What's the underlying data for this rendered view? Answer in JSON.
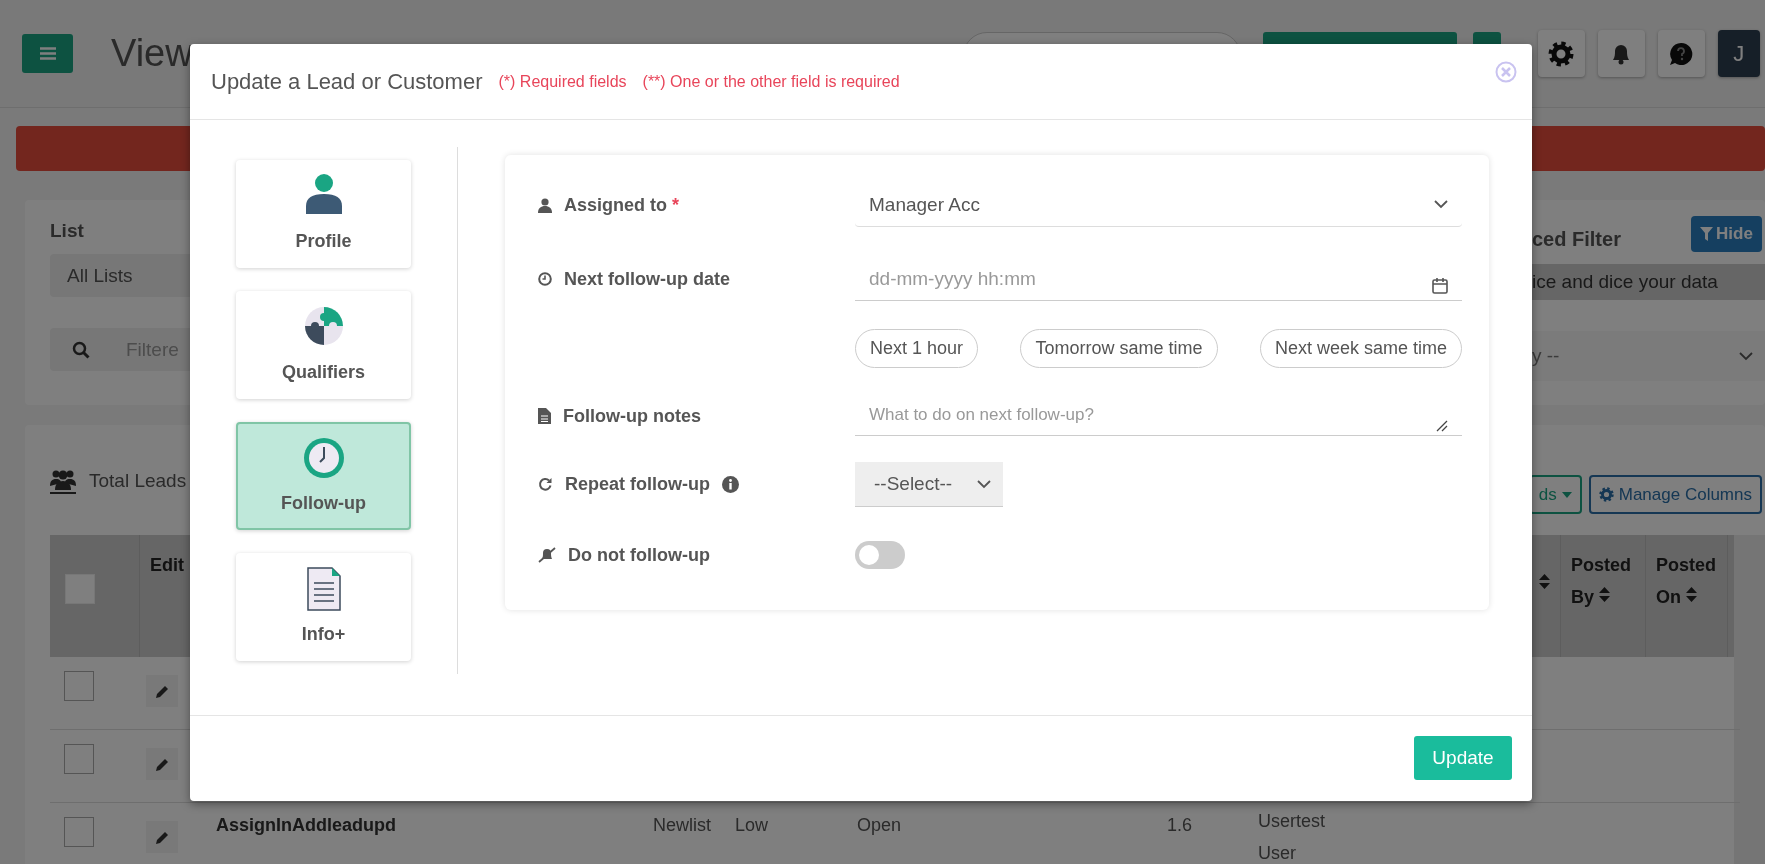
{
  "topbar": {
    "page_title": "View",
    "avatar": "J"
  },
  "filter_panel": {
    "list_label": "List",
    "list_value": "All Lists",
    "search_placeholder": "Filtere",
    "advanced_filter_title": "ced Filter",
    "hide_button": "Hide",
    "slice_hint": "ice and dice your data",
    "sort_select": "y --"
  },
  "leads_panel": {
    "title": "Total Leads",
    "leads_button": "ds",
    "manage_columns_button": "Manage Columns",
    "all_checked": false,
    "columns": [
      {
        "label": "Edit",
        "sortable": false
      },
      {
        "label": "Posted By",
        "sortable": true
      },
      {
        "label": "Posted On",
        "sortable": true
      }
    ],
    "rows": [
      {
        "checked": false
      },
      {
        "checked": false
      },
      {
        "checked": false,
        "name": "AssignInAddleadupd",
        "list": "Newlist",
        "priority": "Low",
        "status": "Open",
        "score": "1.6",
        "user": "Usertest User"
      }
    ]
  },
  "modal": {
    "title": "Update a Lead or Customer",
    "required_note": "(*) Required fields",
    "either_note": "(**) One or the other field is required",
    "nav": [
      {
        "kind": "profile",
        "label": "Profile",
        "selected": false
      },
      {
        "kind": "qualifiers",
        "label": "Qualifiers",
        "selected": false
      },
      {
        "kind": "followup",
        "label": "Follow-up",
        "selected": true
      },
      {
        "kind": "info",
        "label": "Info+",
        "selected": false
      }
    ],
    "fields": [
      {
        "kind": "select",
        "label": "Assigned to",
        "required_mark": "*",
        "value": "Manager Acc"
      },
      {
        "kind": "datetime",
        "label": "Next follow-up date",
        "placeholder": "dd-mm-yyyy hh:mm",
        "shortcuts": [
          "Next 1 hour",
          "Tomorrow same time",
          "Next week same time"
        ]
      },
      {
        "kind": "notes",
        "label": "Follow-up notes",
        "placeholder": "What to do on next follow-up?"
      },
      {
        "kind": "repeat",
        "label": "Repeat follow-up",
        "value": "--Select--"
      },
      {
        "kind": "toggle",
        "label": "Do not follow-up",
        "on": false
      }
    ],
    "update_button": "Update"
  }
}
